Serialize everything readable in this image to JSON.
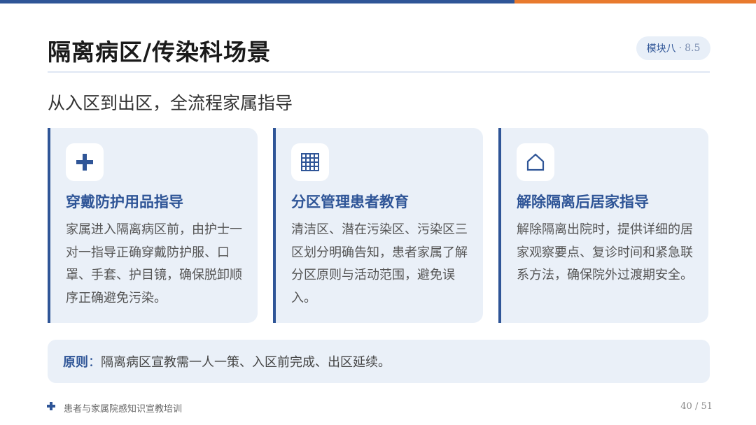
{
  "header": {
    "title": "隔离病区/传染科场景",
    "badge_label": "模块八",
    "badge_separator": "·",
    "badge_number": "8.5",
    "accent_blue": "#2f5597",
    "accent_orange": "#e87a2e"
  },
  "subtitle": "从入区到出区，全流程家属指导",
  "cards": [
    {
      "icon": "plus-icon",
      "title": "穿戴防护用品指导",
      "body": "家属进入隔离病区前，由护士一对一指导正确穿戴防护服、口罩、手套、护目镜，确保脱卸顺序正确避免污染。"
    },
    {
      "icon": "grid-icon",
      "title": "分区管理患者教育",
      "body": "清洁区、潜在污染区、污染区三区划分明确告知，患者家属了解分区原则与活动范围，避免误入。"
    },
    {
      "icon": "home-icon",
      "title": "解除隔离后居家指导",
      "body": "解除隔离出院时，提供详细的居家观察要点、复诊时间和紧急联系方法，确保院外过渡期安全。"
    }
  ],
  "principle": {
    "label": "原则",
    "colon": "：",
    "text": "隔离病区宣教需一人一策、入区前完成、出区延续。"
  },
  "footer": {
    "icon": "plus-icon",
    "text": "患者与家属院感知识宣教培训",
    "page": "40 / 51"
  }
}
